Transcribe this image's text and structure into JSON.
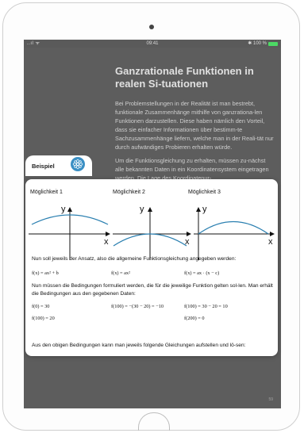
{
  "status_bar": {
    "signal": "..ıl ᯤ",
    "time": "09:41",
    "battery_text": "✱ 100 %"
  },
  "article": {
    "title": "Ganzrationale Funktionen in realen Si-tuationen",
    "paragraph1": "Bei Problemstellungen in der Realität ist man bestrebt, funktionale Zusammenhänge mithilfe von ganzrationa-len Funktionen darzustellen. Diese haben nämlich den Vorteil, dass sie einfacher Informationen über bestimm-te Sachzusammenhänge liefern, welche man in der Reali-tät nur durch aufwändiges Probieren erhalten würde.",
    "paragraph2": "Um die Funktionsgleichung zu erhalten, müssen zu-nächst alle bekannten Daten in ein Koordinatensystem eingetragen werden. Die Lage des Koordinatenur-"
  },
  "page_number": "59",
  "example": {
    "label": "Beispiel",
    "icon": "flower-icon",
    "accent": "#3a8fc4",
    "options": [
      {
        "label": "Möglichkeit 1",
        "x_label": "x",
        "y_label": "y",
        "equation": "f(x) = ax² + b"
      },
      {
        "label": "Möglichkeit 2",
        "x_label": "x",
        "y_label": "y",
        "equation": "f(x) = ax²"
      },
      {
        "label": "Möglichkeit 3",
        "x_label": "x",
        "y_label": "y",
        "equation": "f(x) = ax · (x − c)"
      }
    ],
    "intro_text": "Nun soll jeweils der Ansatz, also die allgemeine Funktionsgleichung angegeben werden:",
    "conditions_text": "Nun müssen die Bedingungen formuliert werden, die für die jeweilige Funktion gelten sol-len. Man erhält die Bedingungen aus den gegebenen Daten:",
    "conditions": {
      "c1a": "f(0) = 30",
      "c1b": "f(100) = 20",
      "c2a": "f(100) = −(30 − 20) = −10",
      "c3a": "f(100) = 30 − 20 = 10",
      "c3b": "f(200) = 0"
    },
    "final_text": "Aus den obigen Bedingungen kann man jeweils folgende Gleichungen aufstellen und lö-sen:",
    "curve_color": "#2a7fb0"
  }
}
